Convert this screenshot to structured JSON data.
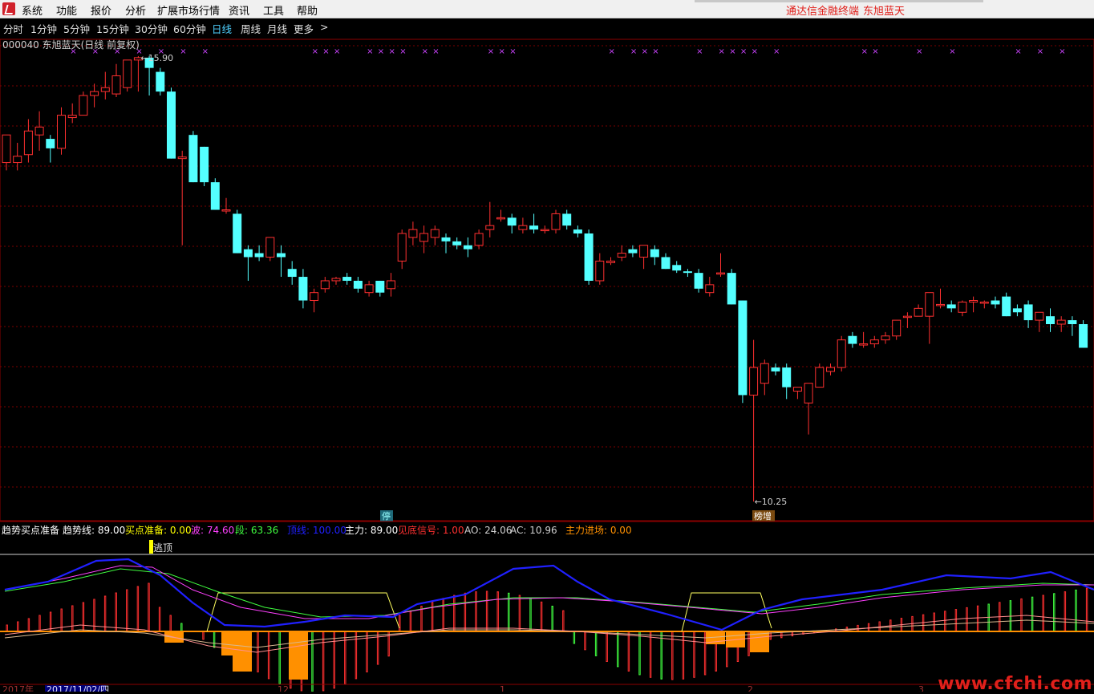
{
  "menu": {
    "items": [
      "系统",
      "功能",
      "报价",
      "分析",
      "扩展市场行情",
      "资讯",
      "工具",
      "帮助"
    ],
    "brand": "通达信金融终端",
    "stock_name": "东旭蓝天"
  },
  "periods": {
    "items": [
      "分时",
      "1分钟",
      "5分钟",
      "15分钟",
      "30分钟",
      "60分钟",
      "日线",
      "周线",
      "月线",
      "更多"
    ],
    "active": "日线",
    "more_arrow": ">"
  },
  "main": {
    "title": "000040 东旭蓝天(日线 前复权)",
    "high_label": "15.90",
    "low_label": "10.25",
    "badge_ting": "停",
    "badge_bang": "榜增",
    "x_marker": "×"
  },
  "indicator": {
    "name": "趋势买点准备",
    "values": [
      {
        "label": "趋势线: 89.00",
        "color": "#ffffff"
      },
      {
        "label": "买点准备: 0.00",
        "color": "#ffff00"
      },
      {
        "label": "波: 74.60",
        "color": "#ff40ff"
      },
      {
        "label": "段: 63.36",
        "color": "#40ff40"
      },
      {
        "label": "顶线: 100.00",
        "color": "#2020ff"
      },
      {
        "label": "主力: 89.00",
        "color": "#ffffff"
      },
      {
        "label": "见底信号: 1.00",
        "color": "#ff3030"
      },
      {
        "label": "AO: 24.06",
        "color": "#d0d0d0"
      },
      {
        "label": "AC: 10.96",
        "color": "#d0d0d0"
      },
      {
        "label": "主力进场: 0.00",
        "color": "#ff9000"
      }
    ],
    "tag": "逃顶"
  },
  "axis": {
    "year": "2017年",
    "date_box": "2017/11/02/四",
    "month_ticks": [
      "12",
      "1",
      "2",
      "3"
    ]
  },
  "watermark": "www.cfchi.com",
  "colors": {
    "up": "#ff3030",
    "down": "#54ffff",
    "grid": "#8b0000",
    "bg": "#000000"
  },
  "chart_data": {
    "type": "candlestick",
    "high_label": 15.9,
    "low_label": 10.25,
    "candles": [
      {
        "o": 14.55,
        "h": 14.75,
        "l": 14.45,
        "c": 14.9
      },
      {
        "o": 14.55,
        "h": 14.8,
        "l": 14.45,
        "c": 14.63
      },
      {
        "o": 14.65,
        "h": 15.1,
        "l": 14.55,
        "c": 14.95
      },
      {
        "o": 14.9,
        "h": 15.2,
        "l": 14.7,
        "c": 15.0
      },
      {
        "o": 14.85,
        "h": 14.9,
        "l": 14.55,
        "c": 14.73
      },
      {
        "o": 14.73,
        "h": 15.25,
        "l": 14.65,
        "c": 15.15
      },
      {
        "o": 15.12,
        "h": 15.3,
        "l": 15.05,
        "c": 15.15
      },
      {
        "o": 15.15,
        "h": 15.45,
        "l": 15.15,
        "c": 15.4
      },
      {
        "o": 15.4,
        "h": 15.55,
        "l": 15.25,
        "c": 15.45
      },
      {
        "o": 15.45,
        "h": 15.7,
        "l": 15.35,
        "c": 15.5
      },
      {
        "o": 15.42,
        "h": 15.8,
        "l": 15.38,
        "c": 15.65
      },
      {
        "o": 15.5,
        "h": 15.85,
        "l": 15.45,
        "c": 15.85
      },
      {
        "o": 15.85,
        "h": 15.9,
        "l": 15.45,
        "c": 15.88
      },
      {
        "o": 15.88,
        "h": 15.9,
        "l": 15.4,
        "c": 15.75
      },
      {
        "o": 15.7,
        "h": 15.75,
        "l": 15.4,
        "c": 15.45
      },
      {
        "o": 15.45,
        "h": 15.5,
        "l": 14.6,
        "c": 14.6
      },
      {
        "o": 14.6,
        "h": 14.7,
        "l": 13.5,
        "c": 14.62
      },
      {
        "o": 14.9,
        "h": 14.95,
        "l": 14.3,
        "c": 14.3
      },
      {
        "o": 14.75,
        "h": 14.75,
        "l": 14.25,
        "c": 14.3
      },
      {
        "o": 14.3,
        "h": 14.35,
        "l": 13.95,
        "c": 13.95
      },
      {
        "o": 13.95,
        "h": 14.1,
        "l": 13.9,
        "c": 13.95
      },
      {
        "o": 13.9,
        "h": 13.95,
        "l": 13.4,
        "c": 13.4
      },
      {
        "o": 13.45,
        "h": 13.5,
        "l": 13.05,
        "c": 13.35
      },
      {
        "o": 13.4,
        "h": 13.5,
        "l": 13.3,
        "c": 13.35
      },
      {
        "o": 13.35,
        "h": 13.6,
        "l": 13.3,
        "c": 13.6
      },
      {
        "o": 13.4,
        "h": 13.5,
        "l": 13.1,
        "c": 13.35
      },
      {
        "o": 13.2,
        "h": 13.3,
        "l": 13.0,
        "c": 13.1
      },
      {
        "o": 13.1,
        "h": 13.2,
        "l": 12.7,
        "c": 12.8
      },
      {
        "o": 12.8,
        "h": 12.95,
        "l": 12.65,
        "c": 12.9
      },
      {
        "o": 12.95,
        "h": 13.1,
        "l": 12.9,
        "c": 13.05
      },
      {
        "o": 13.05,
        "h": 13.1,
        "l": 13.0,
        "c": 13.08
      },
      {
        "o": 13.1,
        "h": 13.15,
        "l": 13.0,
        "c": 13.05
      },
      {
        "o": 13.05,
        "h": 13.1,
        "l": 12.9,
        "c": 12.95
      },
      {
        "o": 12.9,
        "h": 13.05,
        "l": 12.85,
        "c": 13.0
      },
      {
        "o": 13.05,
        "h": 13.05,
        "l": 12.85,
        "c": 12.9
      },
      {
        "o": 12.95,
        "h": 13.15,
        "l": 12.85,
        "c": 13.05
      },
      {
        "o": 13.3,
        "h": 13.7,
        "l": 13.2,
        "c": 13.65
      },
      {
        "o": 13.6,
        "h": 13.8,
        "l": 13.5,
        "c": 13.7
      },
      {
        "o": 13.55,
        "h": 13.75,
        "l": 13.4,
        "c": 13.65
      },
      {
        "o": 13.6,
        "h": 13.75,
        "l": 13.5,
        "c": 13.7
      },
      {
        "o": 13.6,
        "h": 13.65,
        "l": 13.4,
        "c": 13.55
      },
      {
        "o": 13.55,
        "h": 13.6,
        "l": 13.45,
        "c": 13.5
      },
      {
        "o": 13.5,
        "h": 13.6,
        "l": 13.35,
        "c": 13.45
      },
      {
        "o": 13.5,
        "h": 13.7,
        "l": 13.45,
        "c": 13.65
      },
      {
        "o": 13.7,
        "h": 14.05,
        "l": 13.6,
        "c": 13.75
      },
      {
        "o": 13.85,
        "h": 13.95,
        "l": 13.8,
        "c": 13.85
      },
      {
        "o": 13.85,
        "h": 13.9,
        "l": 13.65,
        "c": 13.75
      },
      {
        "o": 13.7,
        "h": 13.85,
        "l": 13.65,
        "c": 13.75
      },
      {
        "o": 13.75,
        "h": 13.9,
        "l": 13.65,
        "c": 13.7
      },
      {
        "o": 13.7,
        "h": 13.75,
        "l": 13.65,
        "c": 13.7
      },
      {
        "o": 13.7,
        "h": 13.95,
        "l": 13.65,
        "c": 13.9
      },
      {
        "o": 13.9,
        "h": 13.95,
        "l": 13.7,
        "c": 13.75
      },
      {
        "o": 13.7,
        "h": 13.75,
        "l": 13.6,
        "c": 13.65
      },
      {
        "o": 13.65,
        "h": 13.7,
        "l": 13.0,
        "c": 13.05
      },
      {
        "o": 13.05,
        "h": 13.4,
        "l": 13.0,
        "c": 13.3
      },
      {
        "o": 13.28,
        "h": 13.35,
        "l": 13.25,
        "c": 13.3
      },
      {
        "o": 13.35,
        "h": 13.5,
        "l": 13.3,
        "c": 13.4
      },
      {
        "o": 13.45,
        "h": 13.5,
        "l": 13.35,
        "c": 13.4
      },
      {
        "o": 13.35,
        "h": 13.5,
        "l": 13.2,
        "c": 13.5
      },
      {
        "o": 13.45,
        "h": 13.5,
        "l": 13.25,
        "c": 13.35
      },
      {
        "o": 13.35,
        "h": 13.4,
        "l": 13.25,
        "c": 13.2
      },
      {
        "o": 13.25,
        "h": 13.3,
        "l": 13.15,
        "c": 13.18
      },
      {
        "o": 13.17,
        "h": 13.2,
        "l": 13.1,
        "c": 13.15
      },
      {
        "o": 13.15,
        "h": 13.2,
        "l": 12.9,
        "c": 12.95
      },
      {
        "o": 12.9,
        "h": 13.1,
        "l": 12.85,
        "c": 13.0
      },
      {
        "o": 13.15,
        "h": 13.4,
        "l": 13.1,
        "c": 13.15
      },
      {
        "o": 13.15,
        "h": 13.2,
        "l": 12.75,
        "c": 12.75
      },
      {
        "o": 12.8,
        "h": 12.8,
        "l": 11.5,
        "c": 11.6
      },
      {
        "o": 11.6,
        "h": 12.3,
        "l": 10.25,
        "c": 11.95
      },
      {
        "o": 11.75,
        "h": 12.05,
        "l": 11.6,
        "c": 12.0
      },
      {
        "o": 11.95,
        "h": 12.0,
        "l": 11.85,
        "c": 11.9
      },
      {
        "o": 11.95,
        "h": 12.0,
        "l": 11.55,
        "c": 11.7
      },
      {
        "o": 11.65,
        "h": 11.7,
        "l": 11.55,
        "c": 11.7
      },
      {
        "o": 11.5,
        "h": 11.75,
        "l": 11.1,
        "c": 11.75
      },
      {
        "o": 11.7,
        "h": 12.0,
        "l": 11.7,
        "c": 11.95
      },
      {
        "o": 11.9,
        "h": 12.0,
        "l": 11.85,
        "c": 11.95
      },
      {
        "o": 11.95,
        "h": 12.35,
        "l": 11.9,
        "c": 12.3
      },
      {
        "o": 12.35,
        "h": 12.4,
        "l": 12.2,
        "c": 12.25
      },
      {
        "o": 12.25,
        "h": 12.4,
        "l": 12.2,
        "c": 12.25
      },
      {
        "o": 12.25,
        "h": 12.35,
        "l": 12.2,
        "c": 12.3
      },
      {
        "o": 12.3,
        "h": 12.4,
        "l": 12.25,
        "c": 12.35
      },
      {
        "o": 12.35,
        "h": 12.55,
        "l": 12.3,
        "c": 12.55
      },
      {
        "o": 12.6,
        "h": 12.65,
        "l": 12.45,
        "c": 12.6
      },
      {
        "o": 12.6,
        "h": 12.75,
        "l": 12.6,
        "c": 12.7
      },
      {
        "o": 12.6,
        "h": 12.65,
        "l": 12.25,
        "c": 12.9
      },
      {
        "o": 12.75,
        "h": 12.95,
        "l": 12.7,
        "c": 12.75
      },
      {
        "o": 12.75,
        "h": 12.8,
        "l": 12.65,
        "c": 12.7
      },
      {
        "o": 12.65,
        "h": 12.8,
        "l": 12.6,
        "c": 12.78
      },
      {
        "o": 12.78,
        "h": 12.85,
        "l": 12.65,
        "c": 12.8
      },
      {
        "o": 12.78,
        "h": 12.8,
        "l": 12.7,
        "c": 12.78
      },
      {
        "o": 12.8,
        "h": 12.85,
        "l": 12.7,
        "c": 12.75
      },
      {
        "o": 12.85,
        "h": 12.9,
        "l": 12.6,
        "c": 12.6
      },
      {
        "o": 12.7,
        "h": 12.75,
        "l": 12.6,
        "c": 12.65
      },
      {
        "o": 12.75,
        "h": 12.8,
        "l": 12.45,
        "c": 12.55
      },
      {
        "o": 12.55,
        "h": 12.6,
        "l": 12.4,
        "c": 12.65
      },
      {
        "o": 12.6,
        "h": 12.7,
        "l": 12.4,
        "c": 12.5
      },
      {
        "o": 12.5,
        "h": 12.6,
        "l": 12.4,
        "c": 12.55
      },
      {
        "o": 12.55,
        "h": 12.6,
        "l": 12.35,
        "c": 12.5
      },
      {
        "o": 12.5,
        "h": 12.55,
        "l": 12.2,
        "c": 12.2
      }
    ],
    "signal_marks": "purple × markers along the top",
    "indicator_series": [
      "趋势线",
      "波",
      "段",
      "顶线",
      "主力",
      "AO",
      "AC"
    ]
  }
}
